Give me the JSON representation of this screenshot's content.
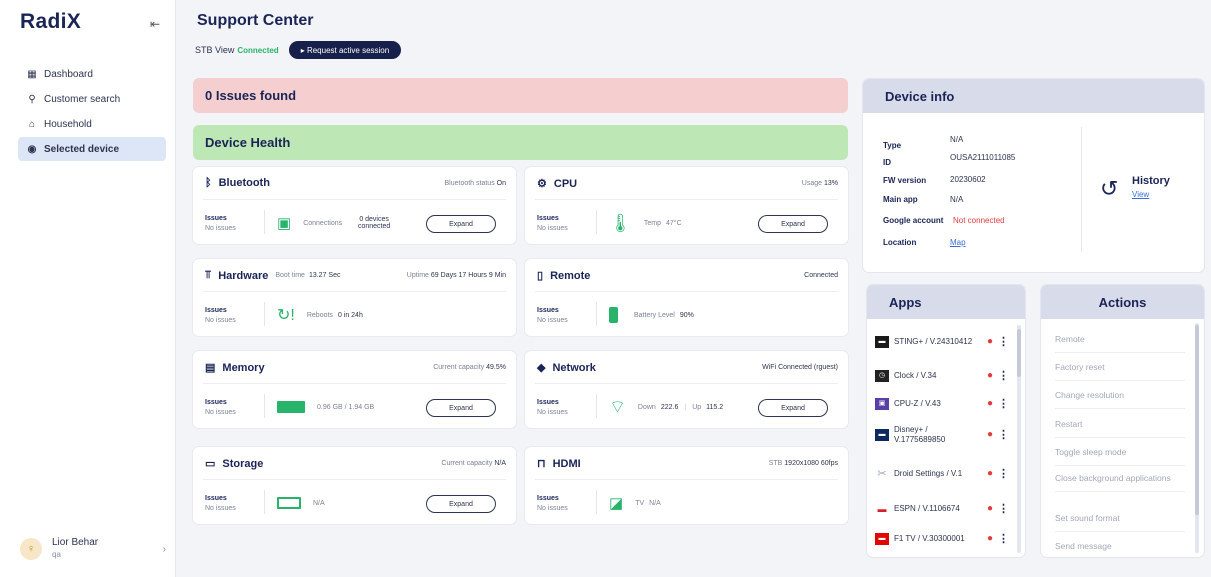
{
  "app": {
    "logo": "RadiX",
    "collapse_icon": "collapse-sidebar-icon"
  },
  "sidebar": {
    "items": [
      {
        "label": "Dashboard",
        "icon": "grid-icon"
      },
      {
        "label": "Customer search",
        "icon": "search-icon"
      },
      {
        "label": "Household",
        "icon": "home-icon"
      },
      {
        "label": "Selected device",
        "icon": "device-icon",
        "active": true
      }
    ],
    "user": {
      "initial": "♀",
      "name": "Lior Behar",
      "role": "qa"
    }
  },
  "header": {
    "title": "Support Center",
    "stb_label": "STB View",
    "stb_status": "Connected",
    "request_button": "▸ Request active session"
  },
  "issues_banner": "0 Issues found",
  "health_banner": "Device Health",
  "cards": {
    "bluetooth": {
      "title": "Bluetooth",
      "meta_label": "Bluetooth status",
      "meta_value": "On",
      "issues_title": "Issues",
      "issues_value": "No issues",
      "body_label": "Connections",
      "body_value": "0 devices connected",
      "expand": "Expand"
    },
    "cpu": {
      "title": "CPU",
      "meta_label": "Usage",
      "meta_value": "13%",
      "issues_title": "Issues",
      "issues_value": "No issues",
      "body_label": "Temp",
      "body_value": "47°C",
      "expand": "Expand"
    },
    "hardware": {
      "title": "Hardware",
      "boot_label": "Boot time",
      "boot_value": "13.27 Sec",
      "uptime_label": "Uptime",
      "uptime_value": "69 Days 17 Hours 9 Min",
      "issues_title": "Issues",
      "issues_value": "No issues",
      "body_label": "Reboots",
      "body_value": "0 in 24h"
    },
    "remote": {
      "title": "Remote",
      "meta_value": "Connected",
      "issues_title": "Issues",
      "issues_value": "No issues",
      "body_label": "Battery Level",
      "body_value": "90%"
    },
    "memory": {
      "title": "Memory",
      "meta_label": "Current capacity",
      "meta_value": "49.5%",
      "issues_title": "Issues",
      "issues_value": "No issues",
      "body_value": "0.96 GB / 1.94 GB",
      "expand": "Expand"
    },
    "network": {
      "title": "Network",
      "meta_value": "WiFi Connected (rguest)",
      "issues_title": "Issues",
      "issues_value": "No issues",
      "down_label": "Down",
      "down_value": "222.6",
      "up_label": "Up",
      "up_value": "115.2",
      "expand": "Expand"
    },
    "storage": {
      "title": "Storage",
      "meta_label": "Current capacity",
      "meta_value": "N/A",
      "issues_title": "Issues",
      "issues_value": "No issues",
      "body_value": "N/A",
      "expand": "Expand"
    },
    "hdmi": {
      "title": "HDMI",
      "meta_label": "STB",
      "meta_value": "1920x1080 60fps",
      "issues_title": "Issues",
      "issues_value": "No issues",
      "body_label": "TV",
      "body_value": "N/A"
    }
  },
  "device_info": {
    "title": "Device info",
    "rows": [
      {
        "label": "Type",
        "value": "N/A"
      },
      {
        "label": "ID",
        "value": "OUSA2111011085"
      },
      {
        "label": "FW version",
        "value": "20230602"
      },
      {
        "label": "Main app",
        "value": "N/A"
      },
      {
        "label": "Google account",
        "value": "Not connected"
      },
      {
        "label": "Location",
        "value": "Map"
      }
    ],
    "history_title": "History",
    "history_link": "View"
  },
  "apps": {
    "title": "Apps",
    "items": [
      {
        "name": "STING+ / V.24310412",
        "color": "#1a1a1a"
      },
      {
        "name": "Clock / V.34",
        "color": "#222222"
      },
      {
        "name": "CPU-Z / V.43",
        "color": "#5b3fa8"
      },
      {
        "name": "Disney+ / V.1775689850",
        "color": "#0e2a5c"
      },
      {
        "name": "Droid Settings / V.1",
        "color": "#9aa3b5"
      },
      {
        "name": "ESPN / V.1106674",
        "color": "#d42027"
      },
      {
        "name": "F1 TV / V.30300001",
        "color": "#e10600"
      }
    ]
  },
  "actions": {
    "title": "Actions",
    "items": [
      "Remote",
      "Factory reset",
      "Change resolution",
      "Restart",
      "Toggle sleep mode",
      "Close background applications",
      "Set sound format",
      "Send message"
    ]
  },
  "colors": {
    "accent": "#16204a",
    "connected": "#27b36a",
    "error": "#e23b3b",
    "issues_bg": "#f5cfd0",
    "health_bg": "#bde8b5"
  }
}
